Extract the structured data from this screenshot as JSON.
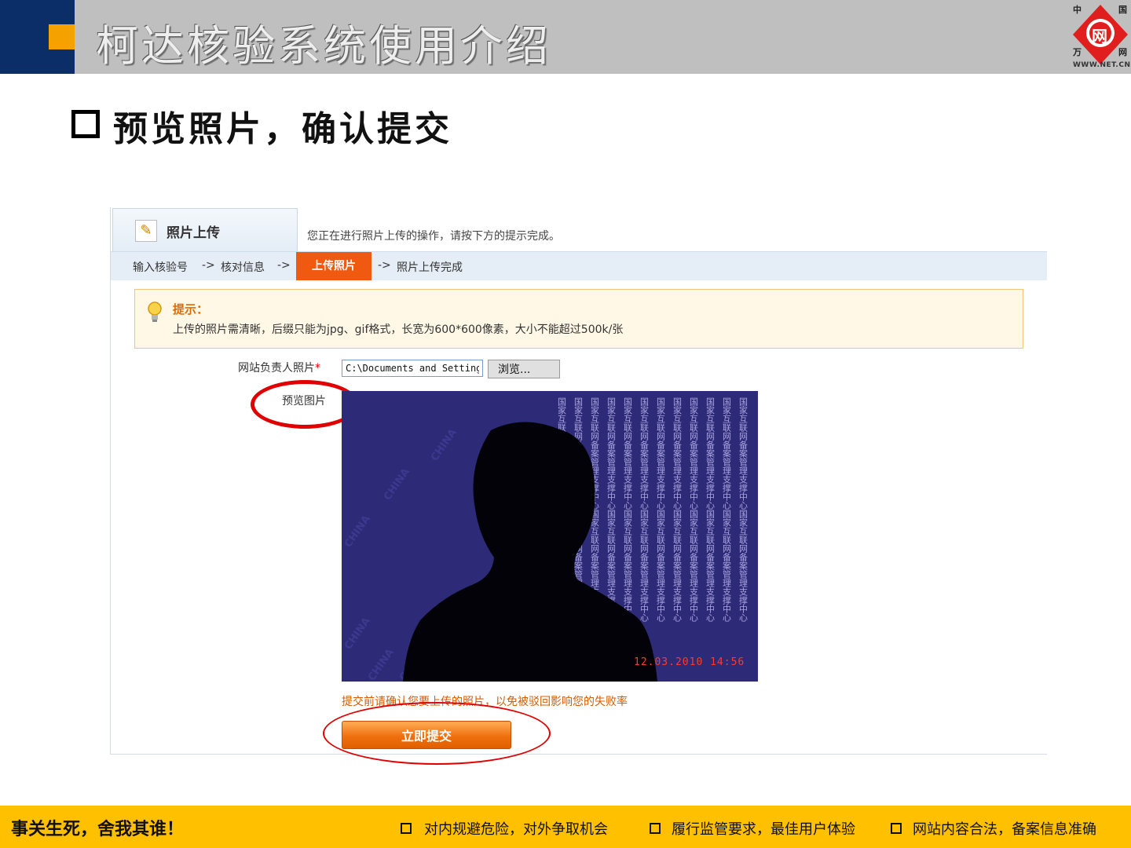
{
  "header": {
    "title": "柯达核验系统使用介绍",
    "logo_chars": [
      "中",
      "国",
      "万",
      "网"
    ],
    "logo_glyph": "网",
    "logo_url": "WWW.NET.CN"
  },
  "section_title": "预览照片，确认提交",
  "panel": {
    "tab_label": "照片上传",
    "intro_text": "您正在进行照片上传的操作，请按下方的提示完成。",
    "steps": [
      "输入核验号",
      "->",
      "核对信息",
      "->",
      "上传照片",
      "->",
      "照片上传完成"
    ],
    "tip_title": "提示：",
    "tip_text": "上传的照片需清晰，后缀只能为jpg、gif格式，长宽为600*600像素，大小不能超过500k/张",
    "upload_label": "网站负责人照片",
    "required_mark": "*",
    "file_value": "C:\\Documents and Settings",
    "browse_label": "浏览...",
    "preview_label": "预览图片",
    "photo_stamp": "12.03.2010 14:56",
    "photo_bg_text": "国家互联网备案管理支撑中心",
    "photo_watermark": "CHINA",
    "warning_text": "提交前请确认您要上传的照片，以免被驳回影响您的失败率",
    "submit_label": "立即提交"
  },
  "footer": {
    "slogan": "事关生死，舍我其谁！",
    "items": [
      "对内规避危险，对外争取机会",
      "履行监管要求，最佳用户体验",
      "网站内容合法，备案信息准确"
    ]
  },
  "colors": {
    "navy": "#0b2d68",
    "header_gray": "#bfbfbf",
    "orange_accent": "#f5a200",
    "footer_yellow": "#ffc000",
    "active_step": "#ef5a10",
    "annotation_red": "#e00000",
    "photo_bg": "#2d2a78"
  }
}
